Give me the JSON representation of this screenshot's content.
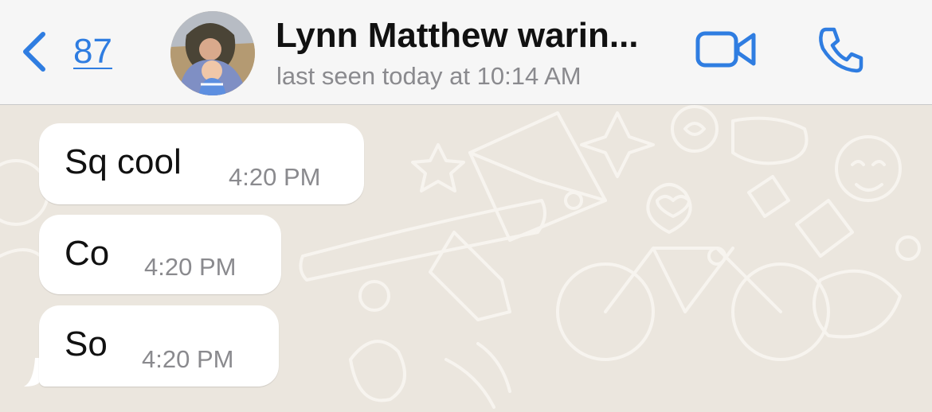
{
  "header": {
    "back_count": "87",
    "contact_name": "Lynn Matthew warin...",
    "status": "last seen today at 10:14 AM",
    "accent_color": "#2f7de1"
  },
  "icons": {
    "back": "chevron-left-icon",
    "video": "video-camera-icon",
    "phone": "phone-icon"
  },
  "messages": [
    {
      "text": "Sq cool",
      "time": "4:20 PM"
    },
    {
      "text": "Co",
      "time": "4:20 PM"
    },
    {
      "text": "So",
      "time": "4:20 PM"
    }
  ],
  "colors": {
    "header_bg": "#f6f6f6",
    "chat_bg": "#ebe6de",
    "bubble_bg": "#ffffff"
  }
}
